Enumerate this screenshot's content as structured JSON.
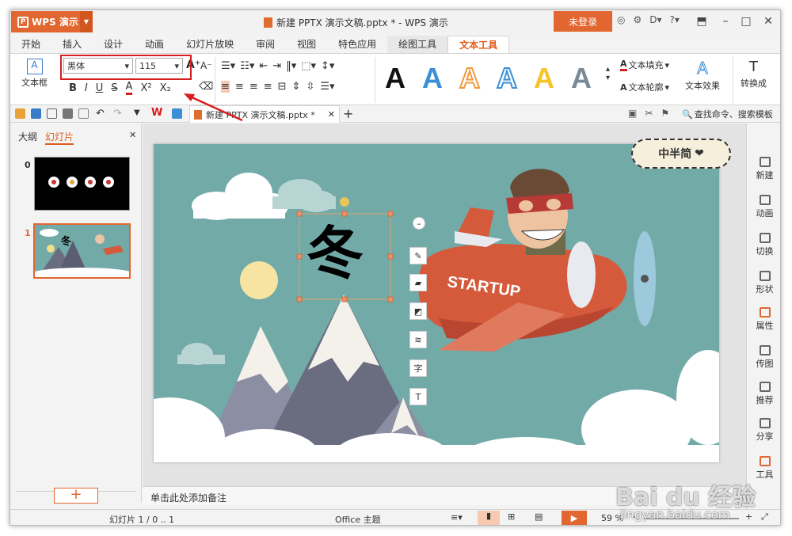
{
  "app": {
    "button_label": "WPS 演示",
    "doc_title": "新建 PPTX 演示文稿.pptx * - WPS 演示",
    "login_label": "未登录"
  },
  "tabs": [
    {
      "label": "开始"
    },
    {
      "label": "插入"
    },
    {
      "label": "设计"
    },
    {
      "label": "动画"
    },
    {
      "label": "幻灯片放映"
    },
    {
      "label": "审阅"
    },
    {
      "label": "视图"
    },
    {
      "label": "特色应用"
    },
    {
      "label": "绘图工具"
    },
    {
      "label": "文本工具"
    }
  ],
  "ribbon": {
    "textbox_label": "文本框",
    "font_name": "黑体",
    "font_size": "115",
    "text_fill_label": "文本填充",
    "text_outline_label": "文本轮廓",
    "text_effect_label": "文本效果",
    "convert_label": "转换成",
    "colors": {
      "black": "#111111",
      "blue": "#3c8fd6",
      "orange": "#f09a3c",
      "light_blue": "#a8d1f0",
      "yellow": "#f5c42a",
      "gray": "#7a8a96"
    }
  },
  "quickbar": {
    "doc_tab_label": "新建 PPTX 演示文稿.pptx *",
    "search_label": "查找命令、搜索模板"
  },
  "left_panel": {
    "tab_outline": "大纲",
    "tab_slides": "幻灯片",
    "slide_numbers": [
      "0",
      "1"
    ],
    "add_label": "+"
  },
  "slide": {
    "main_text": "冬",
    "thumb_text": "冬",
    "plane_text": "STARTUP",
    "sticker_text": "中半简",
    "heart": "❤"
  },
  "notes": {
    "placeholder": "单击此处添加备注"
  },
  "right_bar": [
    {
      "label": "新建"
    },
    {
      "label": "动画"
    },
    {
      "label": "切换"
    },
    {
      "label": "形状"
    },
    {
      "label": "属性"
    },
    {
      "label": "传图"
    },
    {
      "label": "推荐"
    },
    {
      "label": "分享"
    },
    {
      "label": "工具"
    }
  ],
  "status": {
    "slide_info": "幻灯片 1 / 0 .. 1",
    "theme": "Office 主题",
    "zoom": "59 %"
  },
  "watermark": {
    "line1": "Bai du 经验",
    "line2": "jingyan.baidu.com"
  },
  "accent": "#e2662f"
}
